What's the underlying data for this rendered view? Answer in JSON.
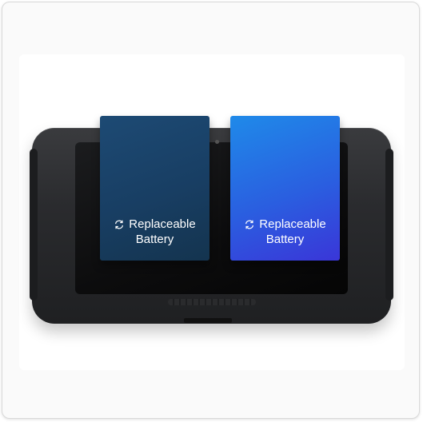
{
  "batteries": [
    {
      "line1": "Replaceable",
      "line2": "Battery",
      "icon": "refresh-icon",
      "color": "#183e63"
    },
    {
      "line1": "Replaceable",
      "line2": "Battery",
      "icon": "refresh-icon",
      "color": "#2a5fe0"
    }
  ],
  "device": {
    "color": "#2a2b2e"
  }
}
